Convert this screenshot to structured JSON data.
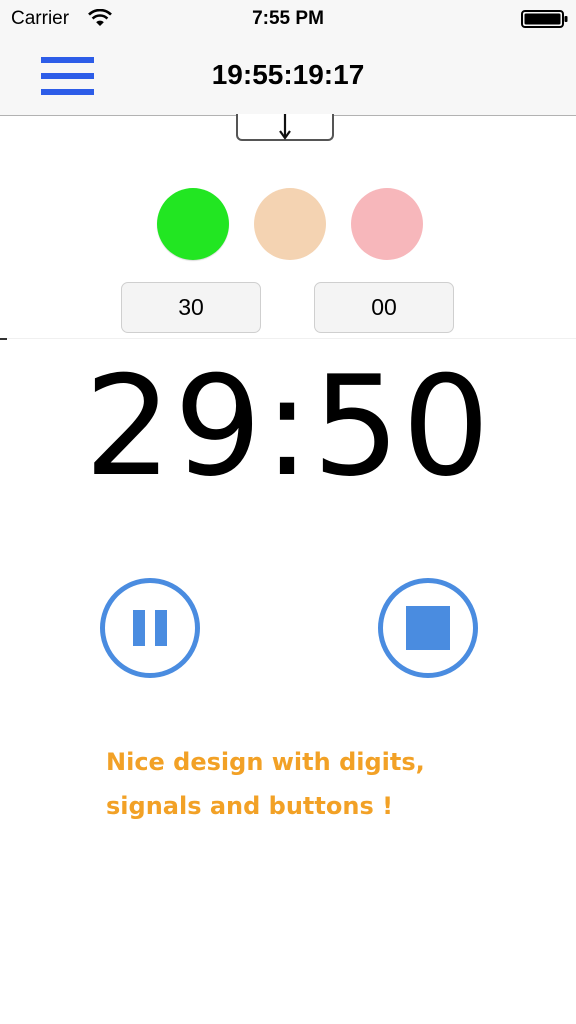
{
  "status_bar": {
    "carrier": "Carrier",
    "time": "7:55 PM",
    "icons": [
      "wifi-icon",
      "battery-icon"
    ]
  },
  "nav_bar": {
    "title": "19:55:19:17",
    "menu_icon": "hamburger-menu-icon",
    "accent_color": "#2d5de8"
  },
  "drop_tab": {
    "icon": "arrow-down-icon"
  },
  "signals": [
    {
      "name": "green",
      "color": "#22e622"
    },
    {
      "name": "peach",
      "color": "#f4d3b2"
    },
    {
      "name": "pink",
      "color": "#f7b7bb"
    }
  ],
  "time_inputs": {
    "minutes": "30",
    "seconds": "00"
  },
  "countdown": {
    "display": "29:50"
  },
  "controls": {
    "pause_icon": "pause-icon",
    "stop_icon": "stop-icon",
    "color": "#4a8ce0"
  },
  "caption": {
    "line1": "Nice design with digits,",
    "line2": "signals and buttons !",
    "color": "#f2a126"
  }
}
